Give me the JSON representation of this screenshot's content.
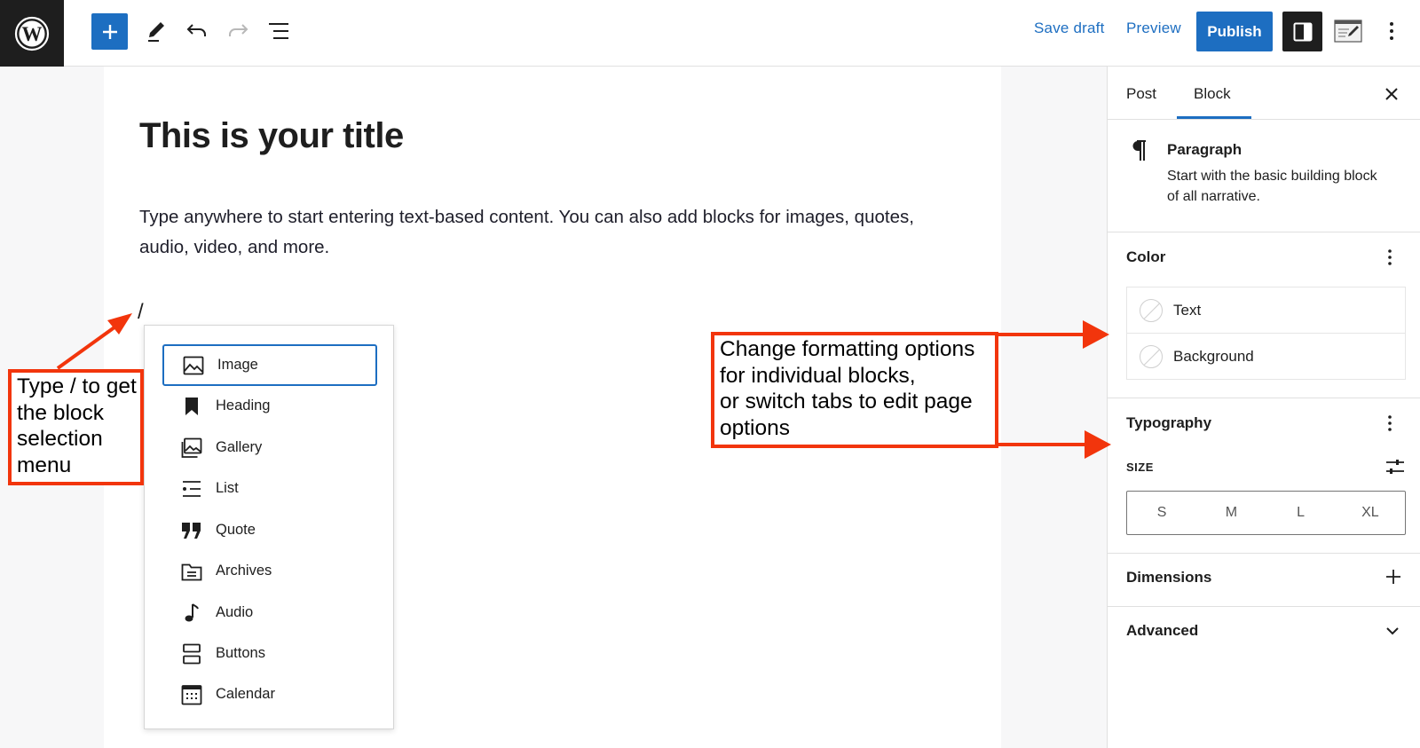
{
  "toolbar": {
    "save_draft": "Save draft",
    "preview": "Preview",
    "publish": "Publish",
    "accent_color": "#1d6ec1"
  },
  "editor": {
    "title": "This is your title",
    "body": "Type anywhere to start entering text-based content. You can also add blocks for images, quotes, audio, video, and more.",
    "slash_command": "/"
  },
  "inserter": {
    "items": [
      {
        "label": "Image",
        "icon": "image-icon"
      },
      {
        "label": "Heading",
        "icon": "bookmark-icon"
      },
      {
        "label": "Gallery",
        "icon": "gallery-icon"
      },
      {
        "label": "List",
        "icon": "list-icon"
      },
      {
        "label": "Quote",
        "icon": "quote-icon"
      },
      {
        "label": "Archives",
        "icon": "archive-icon"
      },
      {
        "label": "Audio",
        "icon": "audio-icon"
      },
      {
        "label": "Buttons",
        "icon": "buttons-icon"
      },
      {
        "label": "Calendar",
        "icon": "calendar-icon"
      }
    ],
    "selected": "Image"
  },
  "sidebar": {
    "tabs": {
      "post": "Post",
      "block": "Block"
    },
    "active_tab": "Block",
    "block_card": {
      "name": "Paragraph",
      "description_line1": "Start with the basic building block",
      "description_line2": "of all narrative."
    },
    "color": {
      "heading": "Color",
      "text": "Text",
      "background": "Background"
    },
    "typography": {
      "heading": "Typography",
      "size_label": "SIZE",
      "sizes": [
        "S",
        "M",
        "L",
        "XL"
      ]
    },
    "dimensions": "Dimensions",
    "advanced": "Advanced"
  },
  "annotations": {
    "left": [
      "Type / to get",
      "the block",
      "selection",
      "menu"
    ],
    "right": [
      "Change formatting options",
      "for individual blocks,",
      "or switch tabs to edit page",
      "options"
    ],
    "color": "#f2350c"
  }
}
